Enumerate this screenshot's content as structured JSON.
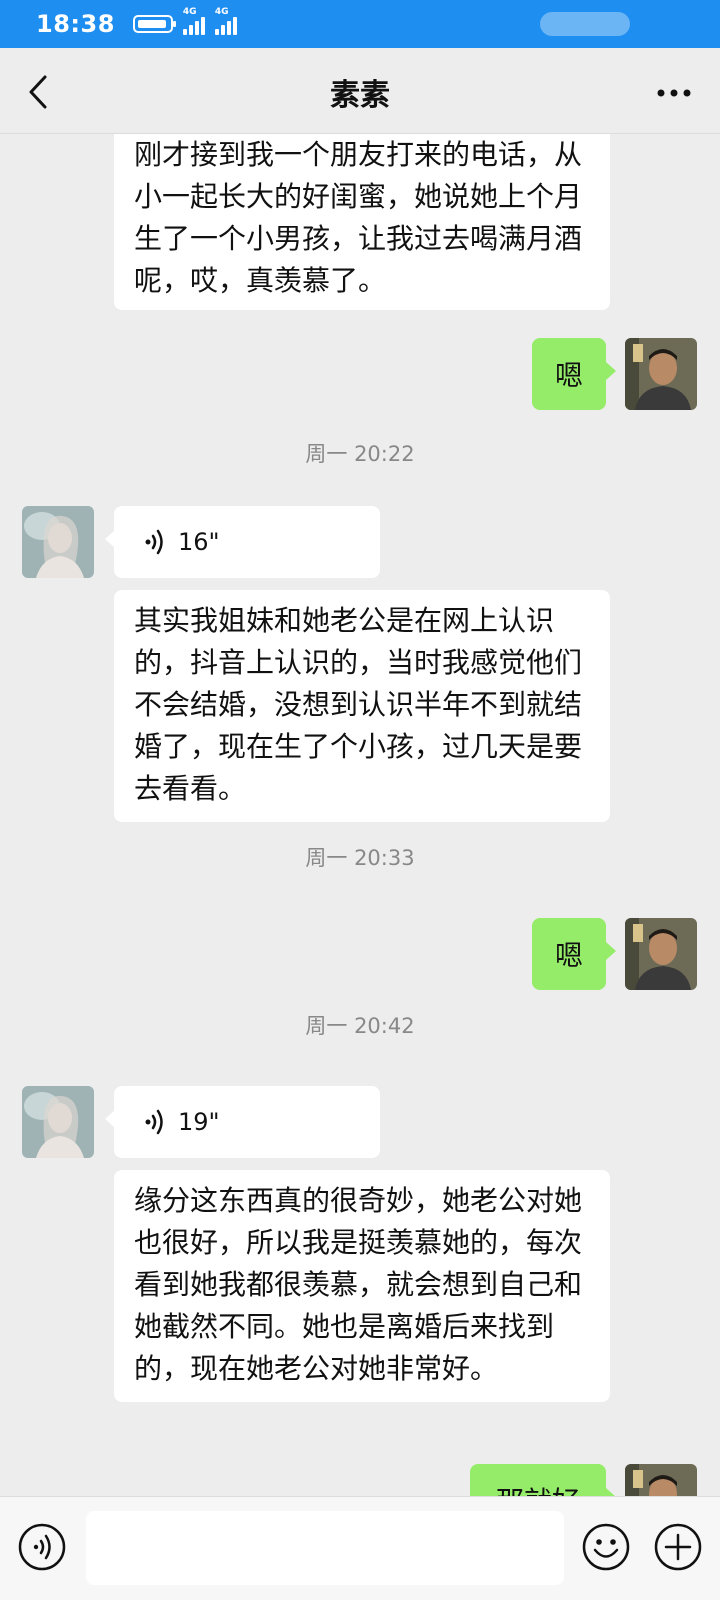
{
  "status_bar": {
    "time": "18:38",
    "signal1_label": "4G",
    "signal2_label": "4G"
  },
  "nav": {
    "title": "素素"
  },
  "messages": {
    "m1_text": "刚才接到我一个朋友打来的电话，从小一起长大的好闺蜜，她说她上个月生了一个小男孩，让我过去喝满月酒呢，哎，真羡慕了。",
    "m2_text": "嗯",
    "t1": "周一 20:22",
    "v1_duration": "16\"",
    "m3_text": "其实我姐妹和她老公是在网上认识的，抖音上认识的，当时我感觉他们不会结婚，没想到认识半年不到就结婚了，现在生了个小孩，过几天是要去看看。",
    "t2": "周一 20:33",
    "m4_text": "嗯",
    "t3": "周一 20:42",
    "v2_duration": "19\"",
    "m5_text": "缘分这东西真的很奇妙，她老公对她也很好，所以我是挺羡慕她的，每次看到她我都很羡慕，就会想到自己和她截然不同。她也是离婚后来找到的，现在她老公对她非常好。",
    "m6_text": "那就好"
  },
  "input": {
    "value": ""
  },
  "colors": {
    "status_bar": "#1e8ef0",
    "chat_bg": "#ededed",
    "my_bubble": "#95ec69",
    "their_bubble": "#ffffff"
  },
  "icons": {
    "back": "chevron-left-icon",
    "more": "more-dots-icon",
    "voice": "voice-wave-icon",
    "emoji": "emoji-icon",
    "plus": "plus-icon"
  }
}
